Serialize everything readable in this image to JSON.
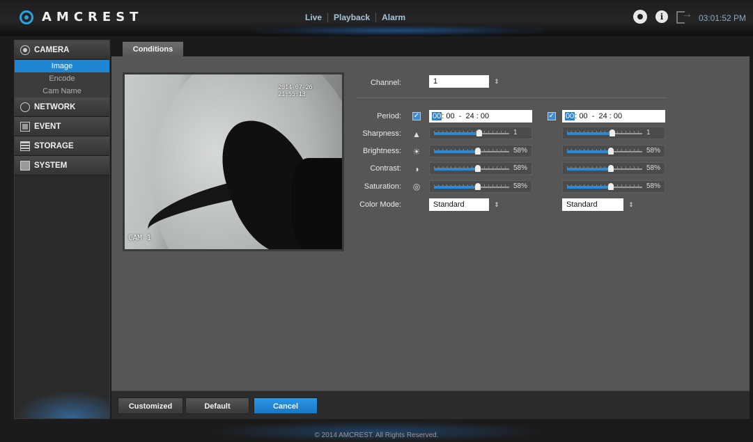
{
  "brand": {
    "name": "AMCREST"
  },
  "nav": {
    "live": "Live",
    "playback": "Playback",
    "alarm": "Alarm"
  },
  "header": {
    "time": "03:01:52 PM"
  },
  "sidebar": {
    "camera": "CAMERA",
    "camera_items": [
      "Image",
      "Encode",
      "Cam Name"
    ],
    "network": "NETWORK",
    "event": "EVENT",
    "storage": "STORAGE",
    "system": "SYSTEM"
  },
  "tab": {
    "conditions": "Conditions"
  },
  "video": {
    "timestamp": "2014-07-26 21:55:13",
    "cam_label": "CAM 1"
  },
  "form": {
    "channel_label": "Channel:",
    "channel_value": "1",
    "period_label": "Period:",
    "sharpness_label": "Sharpness:",
    "brightness_label": "Brightness:",
    "contrast_label": "Contrast:",
    "saturation_label": "Saturation:",
    "color_mode_label": "Color Mode:",
    "profile1": {
      "period_start_hh": "00",
      "period_rest": ": 00  -  24 : 00",
      "sharpness": "1",
      "brightness": "58%",
      "contrast": "58%",
      "saturation": "58%",
      "color_mode": "Standard"
    },
    "profile2": {
      "period_start_hh": "00",
      "period_rest": ": 00  -  24 : 00",
      "sharpness": "1",
      "brightness": "58%",
      "contrast": "58%",
      "saturation": "58%",
      "color_mode": "Standard"
    }
  },
  "slider_levels": {
    "sharpness": 0.6,
    "brightness": 0.58,
    "contrast": 0.58,
    "saturation": 0.58
  },
  "buttons": {
    "customized": "Customized",
    "default": "Default",
    "cancel": "Cancel"
  },
  "footer": {
    "copyright": "© 2014 AMCREST. All Rights Reserved."
  },
  "colors": {
    "accent": "#1e86d2",
    "panel": "#565656",
    "background": "#1b1b1b"
  },
  "icons": [
    "gear-icon",
    "info-icon",
    "logout-icon",
    "camera-icon",
    "network-icon",
    "event-icon",
    "storage-icon",
    "system-icon",
    "sharpness-icon",
    "brightness-icon",
    "contrast-icon",
    "saturation-icon"
  ]
}
